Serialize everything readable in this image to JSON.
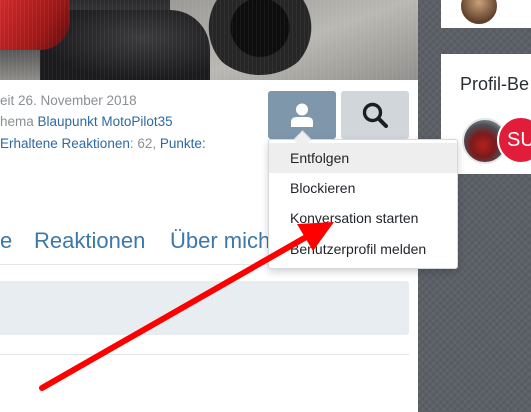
{
  "profile": {
    "meta_line_1": "eit 26. November 2018",
    "meta_line_2_prefix": "hema ",
    "meta_line_2_link": "Blaupunkt MotoPilot35",
    "meta_line_3_reactions_label": "Erhaltene Reaktionen",
    "meta_line_3_reactions_sep": ": ",
    "meta_line_3_reactions_value": "62",
    "meta_line_3_comma": ", ",
    "meta_line_3_points_label": "Punkte",
    "meta_line_3_points_sep": ":"
  },
  "action_buttons": {
    "user_icon": "user-icon",
    "search_icon": "search-icon",
    "user_color": "#7e97ab",
    "search_color": "#d1d6da"
  },
  "dropdown": {
    "items": [
      {
        "label": "Entfolgen"
      },
      {
        "label": "Blockieren"
      },
      {
        "label": "Konversation starten"
      },
      {
        "label": "Benutzerprofil melden"
      }
    ]
  },
  "tabs": [
    {
      "label": "e"
    },
    {
      "label": "Reaktionen"
    },
    {
      "label": "Über mich"
    }
  ],
  "sidebar": {
    "card_title": "Profil-Be",
    "avatar_initials": "SU"
  },
  "annotation": {
    "arrow_color": "#ff0000"
  }
}
